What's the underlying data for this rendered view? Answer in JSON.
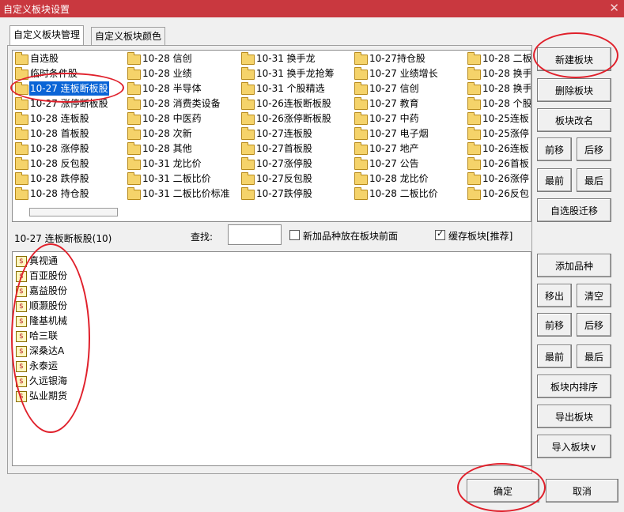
{
  "window": {
    "title": "自定义板块设置",
    "close_glyph": "✕"
  },
  "tabs": [
    "自定义板块管理",
    "自定义板块颜色"
  ],
  "blocks": [
    [
      "自选股",
      "临时条件股",
      "10-27 连板断板股",
      "10-27 涨停断板股",
      "10-28 连板股",
      "10-28 首板股",
      "10-28 涨停股",
      "10-28 反包股",
      "10-28 跌停股",
      "10-28 持仓股"
    ],
    [
      "10-28 信创",
      "10-28 业绩",
      "10-28 半导体",
      "10-28 消费类设备",
      "10-28 中医药",
      "10-28 次新",
      "10-28 其他",
      "10-31 龙比价",
      "10-31 二板比价",
      "10-31 二板比价标准"
    ],
    [
      "10-31 换手龙",
      "10-31 换手龙抢筹",
      "10-31 个股精选",
      "10-26连板断板股",
      "10-26涨停断板股",
      "10-27连板股",
      "10-27首板股",
      "10-27涨停股",
      "10-27反包股",
      "10-27跌停股"
    ],
    [
      "10-27持仓股",
      "10-27 业绩增长",
      "10-27 信创",
      "10-27 教育",
      "10-27 中药",
      "10-27 电子烟",
      "10-27 地产",
      "10-27 公告",
      "10-28 龙比价",
      "10-28 二板比价"
    ],
    [
      "10-28 二板",
      "10-28 换手",
      "10-28 换手",
      "10-28 个股",
      "10-25连板",
      "10-25涨停",
      "10-26连板",
      "10-26首板",
      "10-26涨停",
      "10-26反包"
    ]
  ],
  "selected_block": "10-27 连板断板股",
  "current_block_label": "10-27 连板断板股(10)",
  "search": {
    "label": "查找:",
    "value": ""
  },
  "options": [
    {
      "label": "新加品种放在板块前面",
      "checked": false
    },
    {
      "label": "缓存板块[推荐]",
      "checked": true
    }
  ],
  "stock_icon_glyph": "$",
  "stocks": [
    "真视通",
    "百亚股份",
    "嘉益股份",
    "顺灏股份",
    "隆基机械",
    "哈三联",
    "深桑达A",
    "永泰运",
    "久远银海",
    "弘业期货"
  ],
  "block_buttons": {
    "new": "新建板块",
    "delete": "删除板块",
    "rename": "板块改名",
    "forward": "前移",
    "backward": "后移",
    "first": "最前",
    "last": "最后",
    "migrate": "自选股迁移"
  },
  "stock_buttons": {
    "add": "添加品种",
    "remove": "移出",
    "clear": "清空",
    "forward": "前移",
    "backward": "后移",
    "first": "最前",
    "last": "最后",
    "sort": "板块内排序",
    "export": "导出板块",
    "import": "导入板块∨"
  },
  "footer": {
    "ok": "确定",
    "cancel": "取消"
  },
  "colors": {
    "titlebar": "#c9383f",
    "selection": "#0a64d6",
    "annotation_ring": "#e0202b"
  }
}
